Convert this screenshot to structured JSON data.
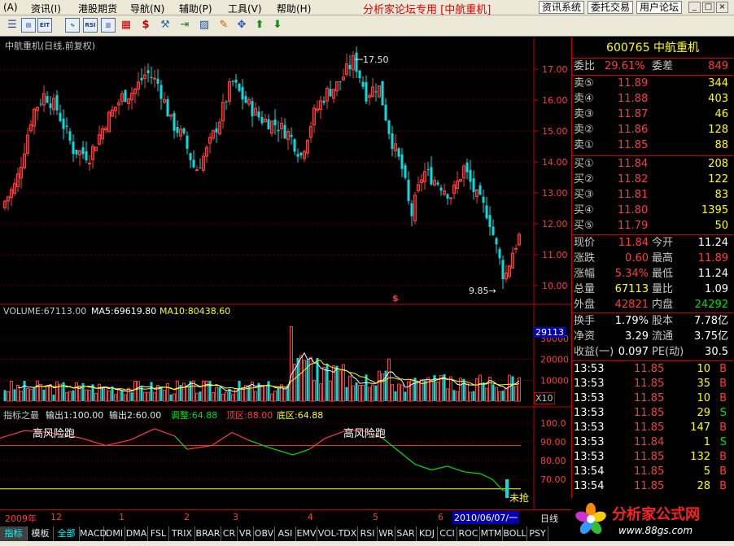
{
  "menubar": {
    "items": [
      "(A)",
      "资讯(I)",
      "港股期货",
      "导航(N)",
      "辅助(P)",
      "工具(V)",
      "帮助(H)"
    ],
    "title": "分析家论坛专用 [中航重机]",
    "buttons": [
      "资讯系统",
      "委托交易",
      "用户论坛"
    ],
    "window_buttons": [
      "_",
      "□",
      "×"
    ]
  },
  "toolbar": {
    "icons": [
      "list-icon",
      "doc-icon",
      "eit-icon",
      "wave-icon",
      "rsi-icon",
      "report-icon",
      "dollar-icon",
      "tools-icon",
      "enter-icon",
      "chart-icon",
      "pencil-icon",
      "move-icon",
      "up-arrow-icon",
      "down-arrow-icon"
    ]
  },
  "kline": {
    "title": "中航重机(日线,前复权)",
    "high_label": "17.50",
    "low_label": "9.85→",
    "marker": "$",
    "yticks": [
      "17.00",
      "16.00",
      "15.00",
      "14.00",
      "13.00",
      "12.00",
      "11.00",
      "10.00"
    ]
  },
  "volume": {
    "label": "VOLUME:67113.00",
    "ma5": "MA5:69619.80",
    "ma10": "MA10:80438.60",
    "current": "29113",
    "yticks": [
      "30000",
      "20000",
      "10000"
    ],
    "unit": "X10"
  },
  "indicator": {
    "name": "指标之最",
    "out1": "输出1:100.00",
    "out2": "输出2:60.00",
    "adjust": "调整:64.88",
    "top": "顶区:88.00",
    "bottom": "底区:64.88",
    "annot1": "高风险跑",
    "annot2": "高风险跑",
    "annot3": "未抢",
    "yticks": [
      "100.0",
      "90.00",
      "80.00",
      "70.00"
    ]
  },
  "dates": {
    "labels": [
      "2009年",
      "12",
      "1",
      "2",
      "3",
      "4",
      "5",
      "6"
    ],
    "current": "2010/06/07/一",
    "period": "日线"
  },
  "tabs": [
    "指标",
    "模板",
    "全部",
    "MACD",
    "DMI",
    "DMA",
    "FSL",
    "TRIX",
    "BRAR",
    "CR",
    "VR",
    "OBV",
    "ASI",
    "EMV",
    "VOL-TDX",
    "RSI",
    "WR",
    "SAR",
    "KDJ",
    "CCI",
    "ROC",
    "MTM",
    "BOLL",
    "PSY"
  ],
  "quote": {
    "code_name": "600765 中航重机",
    "webi_label": "委比",
    "webi_value": "29.61%",
    "weicha_label": "委差",
    "weicha_value": "849",
    "sell": [
      {
        "label": "卖⑤",
        "price": "11.89",
        "vol": "344"
      },
      {
        "label": "卖④",
        "price": "11.88",
        "vol": "403"
      },
      {
        "label": "卖③",
        "price": "11.87",
        "vol": "46"
      },
      {
        "label": "卖②",
        "price": "11.86",
        "vol": "128"
      },
      {
        "label": "卖①",
        "price": "11.85",
        "vol": "88"
      }
    ],
    "buy": [
      {
        "label": "买①",
        "price": "11.84",
        "vol": "208"
      },
      {
        "label": "买②",
        "price": "11.82",
        "vol": "122"
      },
      {
        "label": "买③",
        "price": "11.81",
        "vol": "83"
      },
      {
        "label": "买④",
        "price": "11.80",
        "vol": "1395"
      },
      {
        "label": "买⑤",
        "price": "11.79",
        "vol": "50"
      }
    ],
    "stats": [
      {
        "l1": "现价",
        "v1": "11.84",
        "l2": "今开",
        "v2": "11.24"
      },
      {
        "l1": "涨跌",
        "v1": "0.60",
        "l2": "最高",
        "v2": "11.89"
      },
      {
        "l1": "涨幅",
        "v1": "5.34%",
        "l2": "最低",
        "v2": "11.24"
      },
      {
        "l1": "总量",
        "v1": "67113",
        "l2": "量比",
        "v2": "1.09"
      },
      {
        "l1": "外盘",
        "v1": "42821",
        "l2": "内盘",
        "v2": "24292"
      }
    ],
    "fin": [
      {
        "l1": "换手",
        "v1": "1.79%",
        "l2": "股本",
        "v2": "7.78亿"
      },
      {
        "l1": "净资",
        "v1": "3.29",
        "l2": "流通",
        "v2": "3.75亿"
      },
      {
        "l1": "收益(一)",
        "v1": "0.097",
        "l2": "PE(动)",
        "v2": "30.5"
      }
    ],
    "ticks": [
      {
        "time": "13:53",
        "price": "11.85",
        "vol": "10",
        "dir": "B"
      },
      {
        "time": "13:53",
        "price": "11.85",
        "vol": "35",
        "dir": "B"
      },
      {
        "time": "13:53",
        "price": "11.85",
        "vol": "10",
        "dir": "B"
      },
      {
        "time": "13:53",
        "price": "11.85",
        "vol": "29",
        "dir": "S"
      },
      {
        "time": "13:53",
        "price": "11.85",
        "vol": "147",
        "dir": "B"
      },
      {
        "time": "13:53",
        "price": "11.84",
        "vol": "1",
        "dir": "S"
      },
      {
        "time": "13:53",
        "price": "11.85",
        "vol": "132",
        "dir": "B"
      },
      {
        "time": "13:54",
        "price": "11.85",
        "vol": "5",
        "dir": "B"
      },
      {
        "time": "13:54",
        "price": "11.85",
        "vol": "28",
        "dir": "B"
      }
    ]
  },
  "logo": {
    "title": "分析家公式网",
    "url": "www.88gs.com"
  },
  "colors": {
    "up": "#ff3c3c",
    "down": "#00e0e0",
    "grid": "#c00000",
    "ma5": "#ffffff",
    "ma10": "#ffff00"
  }
}
